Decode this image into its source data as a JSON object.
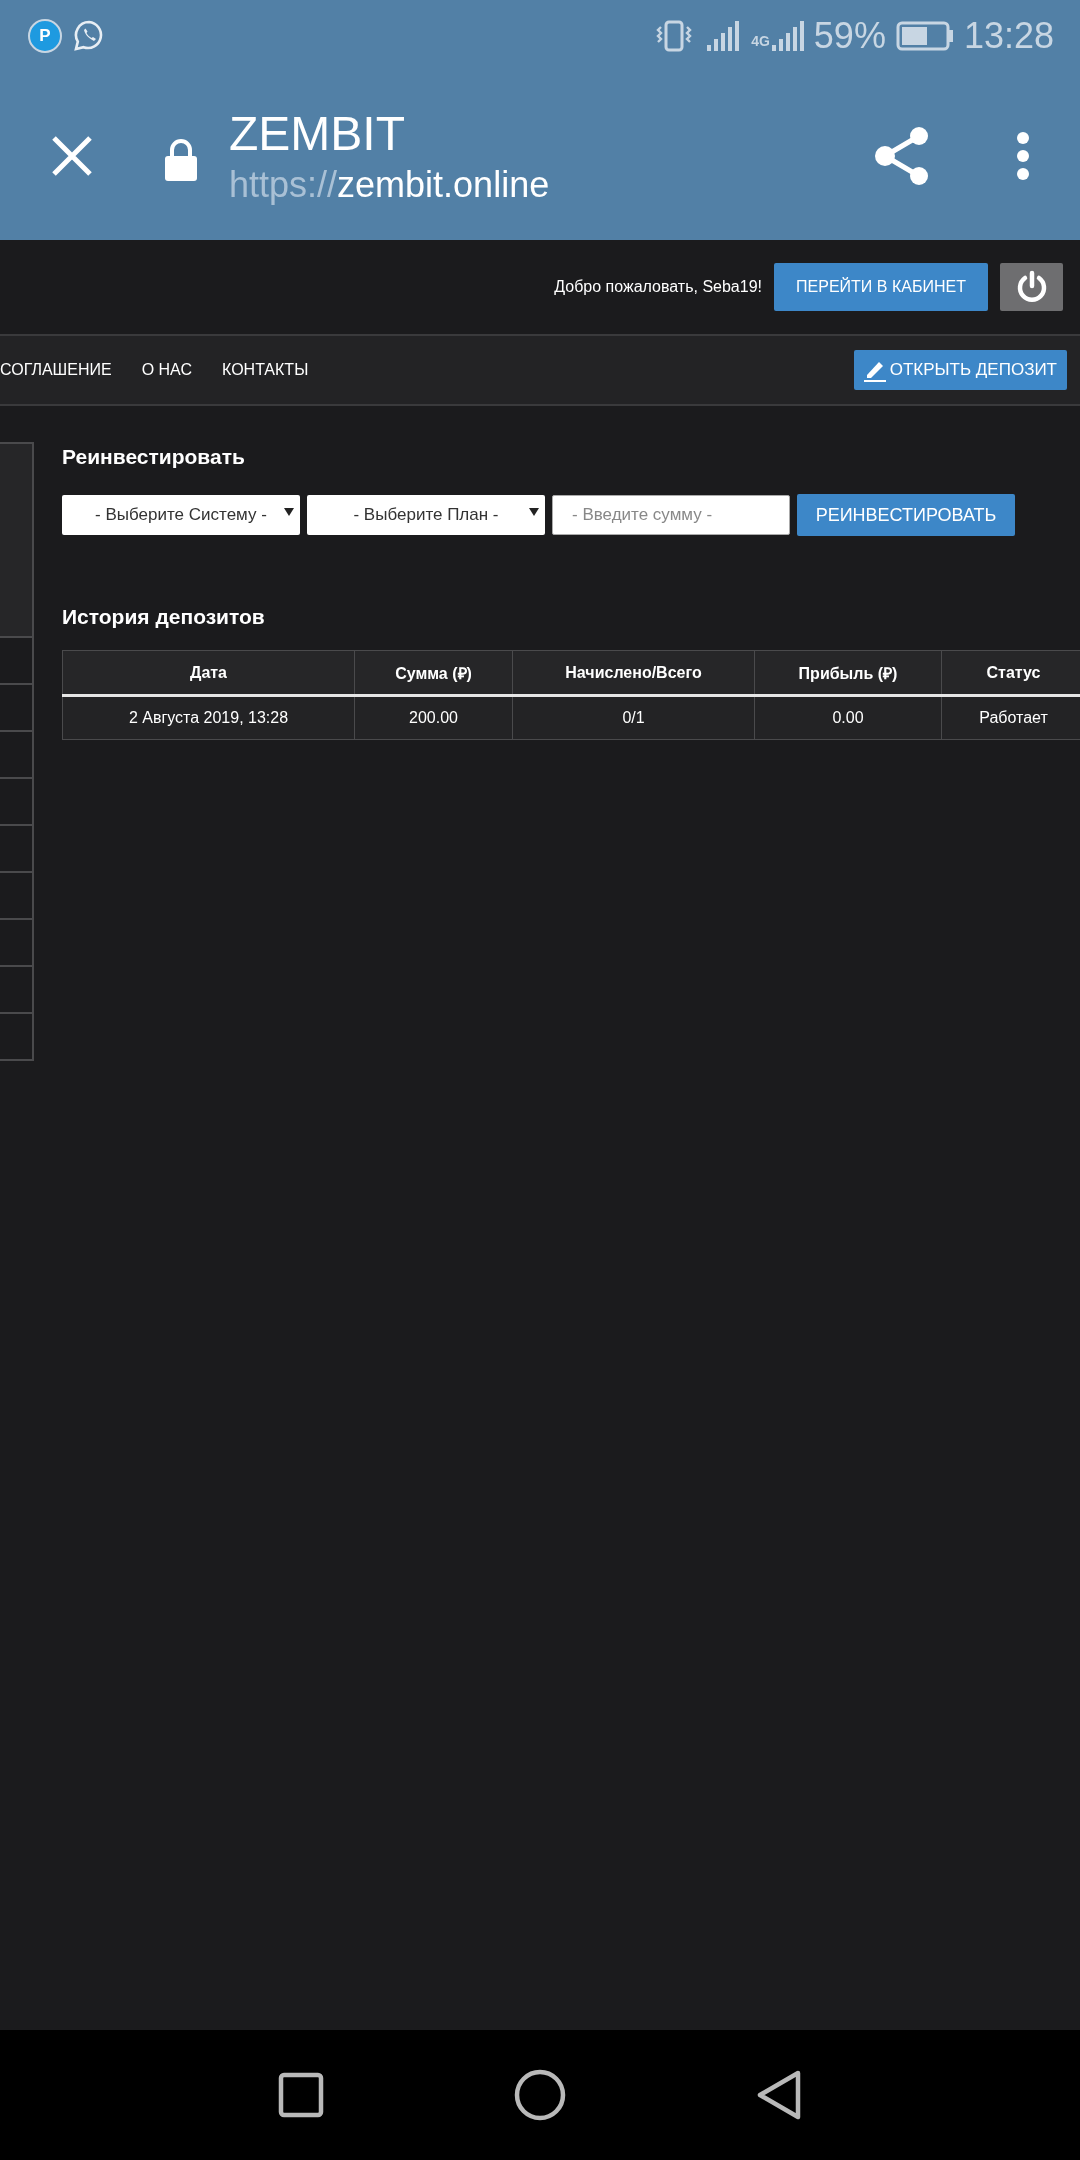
{
  "status_bar": {
    "app_badge": "P",
    "network": "4G",
    "battery": "59%",
    "time": "13:28"
  },
  "browser_bar": {
    "title": "ZEMBIT",
    "url_scheme": "https://",
    "url_host": "zembit.online"
  },
  "top_bar": {
    "welcome": "Добро пожаловать, Seba19!",
    "cabinet_button": "ПЕРЕЙТИ В КАБИНЕТ"
  },
  "nav": {
    "links": [
      "СОГЛАШЕНИЕ",
      "О НАС",
      "КОНТАКТЫ"
    ],
    "deposit_button": "ОТКРЫТЬ ДЕПОЗИТ"
  },
  "reinvest": {
    "title": "Реинвестировать",
    "system_select": "- Выберите Систему -",
    "plan_select": "- Выберите План -",
    "amount": {
      "placeholder": "- Введите сумму -"
    },
    "button": "РЕИНВЕСТИРОВАТЬ"
  },
  "history": {
    "title": "История депозитов",
    "table": {
      "columns": [
        "Дата",
        "Сумма (₽)",
        "Начислено/Всего",
        "Прибыль (₽)",
        "Статус"
      ],
      "rows": [
        [
          "2 Августа 2019, 13:28",
          "200.00",
          "0/1",
          "0.00",
          "Работает"
        ]
      ]
    }
  }
}
